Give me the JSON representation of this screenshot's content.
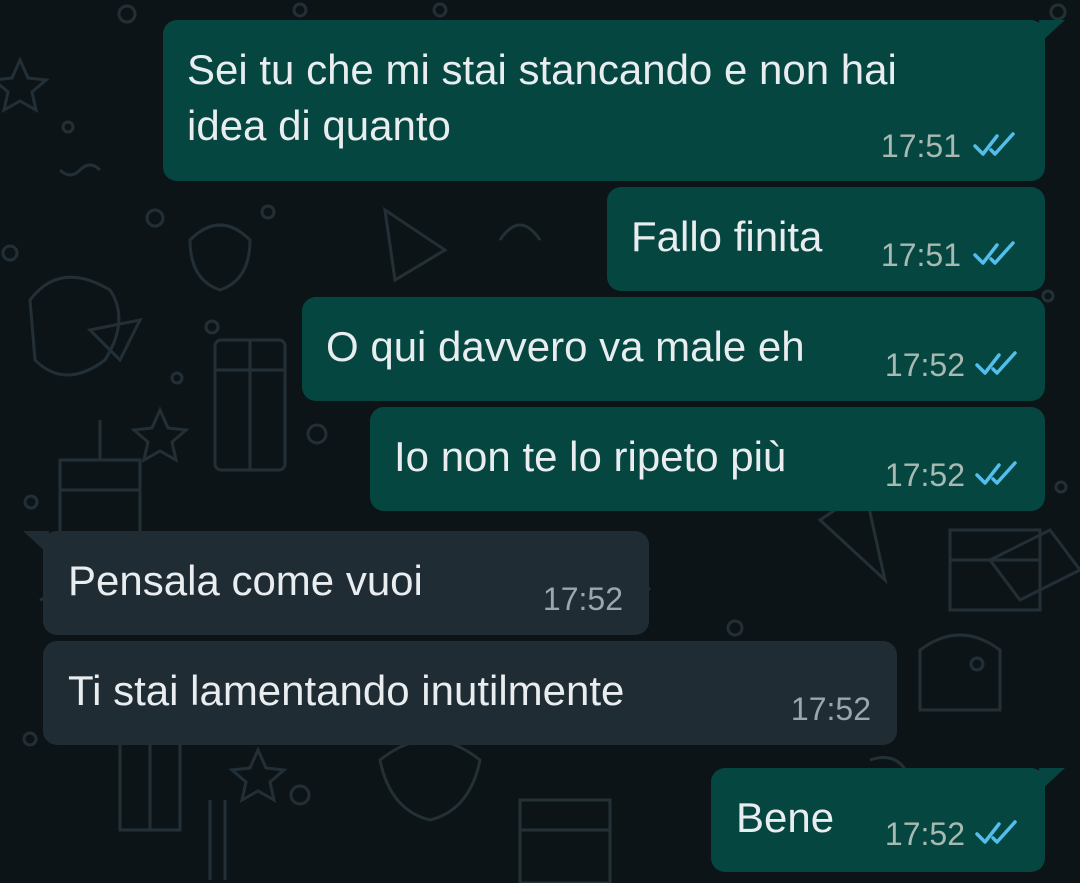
{
  "chat": {
    "messages": [
      {
        "direction": "outgoing",
        "text_line1": "Sei tu che mi stai stancando e non hai",
        "text_line2": "idea di quanto",
        "time": "17:51",
        "status": "read",
        "status_icon": "double-check-blue"
      },
      {
        "direction": "outgoing",
        "text": "Fallo finita",
        "time": "17:51",
        "status": "read",
        "status_icon": "double-check-blue"
      },
      {
        "direction": "outgoing",
        "text": "O qui davvero va male eh",
        "time": "17:52",
        "status": "read",
        "status_icon": "double-check-blue"
      },
      {
        "direction": "outgoing",
        "text": "Io non te lo ripeto più",
        "time": "17:52",
        "status": "read",
        "status_icon": "double-check-blue"
      },
      {
        "direction": "incoming",
        "text": "Pensala come vuoi",
        "time": "17:52"
      },
      {
        "direction": "incoming",
        "text": "Ti stai lamentando inutilmente",
        "time": "17:52"
      },
      {
        "direction": "outgoing",
        "text": "Bene",
        "time": "17:52",
        "status": "read",
        "status_icon": "double-check-blue"
      }
    ]
  },
  "colors": {
    "background": "#0d1418",
    "outgoing_bubble": "#054740",
    "incoming_bubble": "#1f2c33",
    "text": "#e9edef",
    "read_ticks": "#53bdeb"
  }
}
